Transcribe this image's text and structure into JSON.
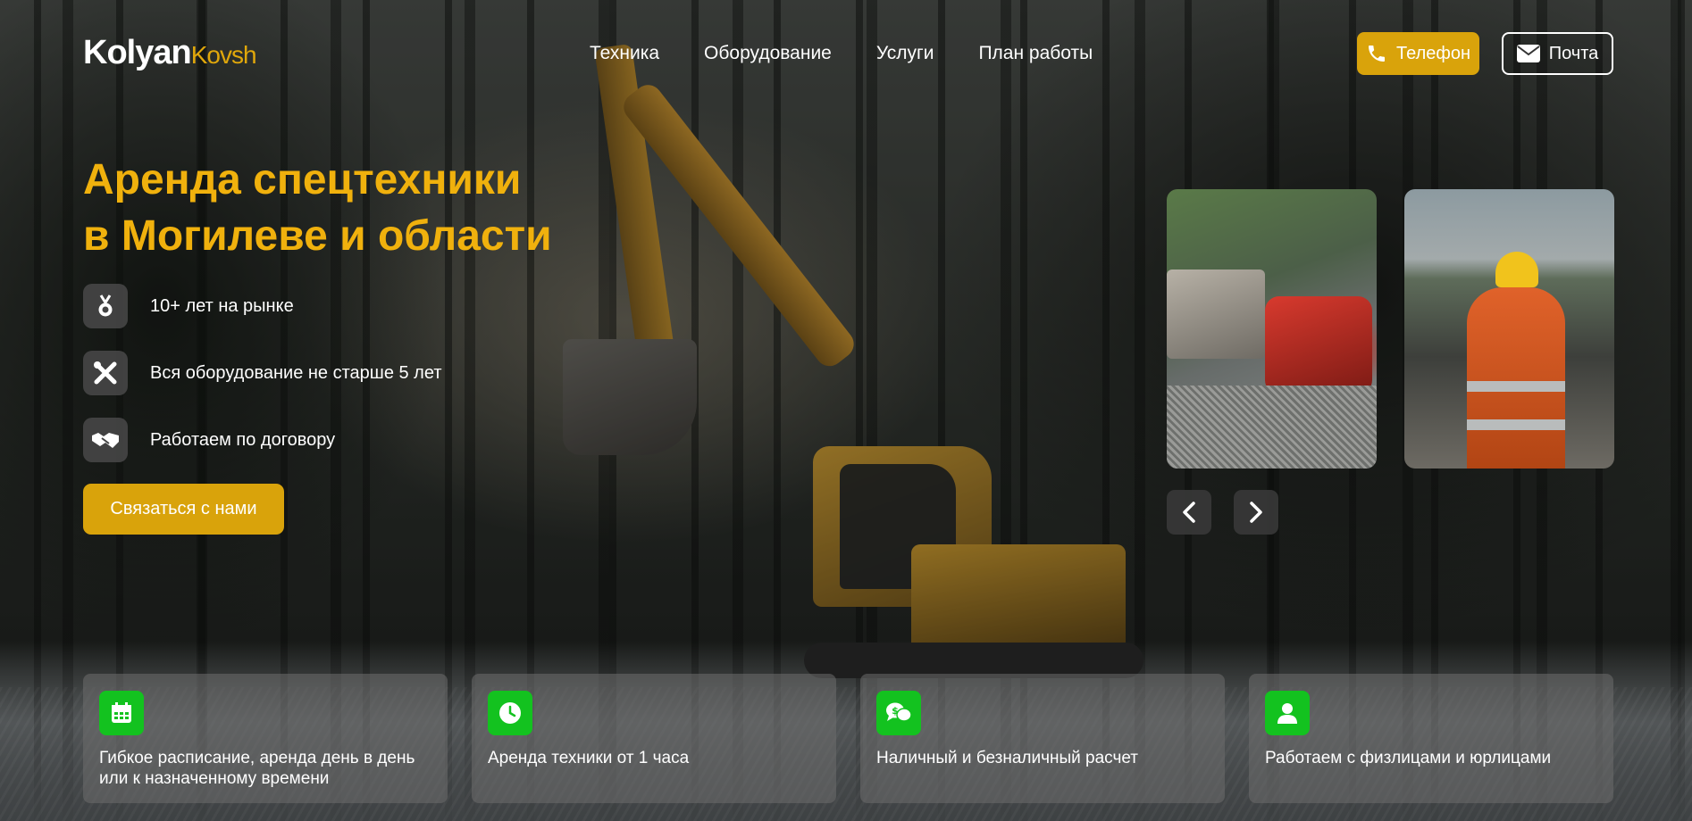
{
  "header": {
    "logo_main": "Kolyan",
    "logo_accent": "Kovsh",
    "nav": [
      {
        "label": "Техника"
      },
      {
        "label": "Оборудование"
      },
      {
        "label": "Услуги"
      },
      {
        "label": "План работы"
      }
    ],
    "phone_label": "Телефон",
    "mail_label": "Почта"
  },
  "hero": {
    "title_line1": "Аренда спецтехники",
    "title_line2": "в Могилеве и области",
    "features": [
      {
        "icon": "medal-icon",
        "text": "10+ лет на рынке"
      },
      {
        "icon": "tools-icon",
        "text": "Вся оборудование не старше 5 лет"
      },
      {
        "icon": "handshake-icon",
        "text": "Работаем по договору"
      }
    ],
    "cta_label": "Связаться с нами"
  },
  "gallery": {
    "slides": [
      {
        "name": "loader-photo"
      },
      {
        "name": "worker-photo"
      }
    ],
    "prev_icon": "chevron-left-icon",
    "next_icon": "chevron-right-icon"
  },
  "benefits": [
    {
      "icon": "calendar-icon",
      "text": "Гибкое расписание, аренда день в день или к назначенному времени"
    },
    {
      "icon": "clock-icon",
      "text": "Аренда техники от 1 часа"
    },
    {
      "icon": "money-chat-icon",
      "text": "Наличный и безналичный расчет"
    },
    {
      "icon": "user-icon",
      "text": "Работаем с физлицами и юрлицами"
    }
  ],
  "colors": {
    "accent": "#d9a30b",
    "title": "#f0b10d",
    "green": "#13c21f"
  }
}
